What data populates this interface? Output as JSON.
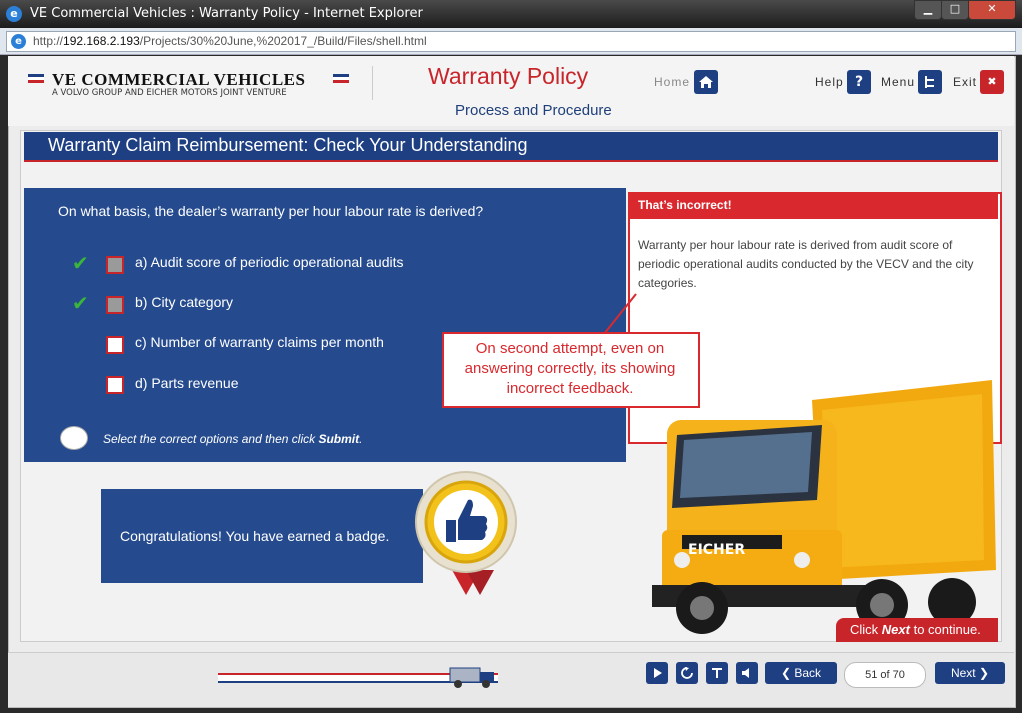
{
  "window": {
    "title": "VE Commercial Vehicles : Warranty Policy - Internet Explorer",
    "minimize": "▁",
    "maximize": "□",
    "close": "✕"
  },
  "address_bar": {
    "url_prefix": "http://",
    "url_host": "192.168.2.193",
    "url_path": "/Projects/30%20June,%202017_/Build/Files/shell.html"
  },
  "logo": {
    "name": "VE COMMERCIAL VEHICLES",
    "tagline": "A VOLVO GROUP AND EICHER MOTORS JOINT VENTURE"
  },
  "course": {
    "title": "Warranty Policy",
    "subtitle": "Process and Procedure"
  },
  "header_nav": {
    "home": "Home",
    "help": "Help",
    "menu": "Menu",
    "exit": "Exit",
    "help_glyph": "?",
    "exit_glyph": "✖"
  },
  "slide": {
    "title": "Warranty Claim Reimbursement: Check Your Understanding",
    "question": "On what basis, the dealer’s warranty per hour labour rate is derived?",
    "options": [
      {
        "label": "a) Audit score of periodic operational audits",
        "checked": true,
        "correct": true
      },
      {
        "label": "b) City category",
        "checked": true,
        "correct": true
      },
      {
        "label": "c) Number of warranty claims per month",
        "checked": false,
        "correct": false
      },
      {
        "label": "d) Parts revenue",
        "checked": false,
        "correct": false
      }
    ],
    "instruction_prefix": "Select the correct options and then click ",
    "instruction_bold": "Submit",
    "instruction_suffix": "."
  },
  "feedback": {
    "title": "That’s incorrect!",
    "body": "Warranty per hour labour rate is derived from audit score of periodic operational audits conducted by the VECV and the city categories."
  },
  "annotation": {
    "text": "On second attempt, even on answering correctly, its showing incorrect feedback."
  },
  "badge": {
    "text": "Congratulations! You have earned a badge."
  },
  "truck": {
    "brand": "EICHER"
  },
  "continue": {
    "prefix": "Click ",
    "bold": "Next",
    "suffix": " to continue."
  },
  "footer": {
    "back": "Back",
    "next": "Next",
    "page_indicator": "51 of 70"
  },
  "colors": {
    "brand_blue": "#1e3f82",
    "brand_red": "#c8252b",
    "panel_blue": "#254b8e",
    "tick_green": "#3ab53a"
  }
}
